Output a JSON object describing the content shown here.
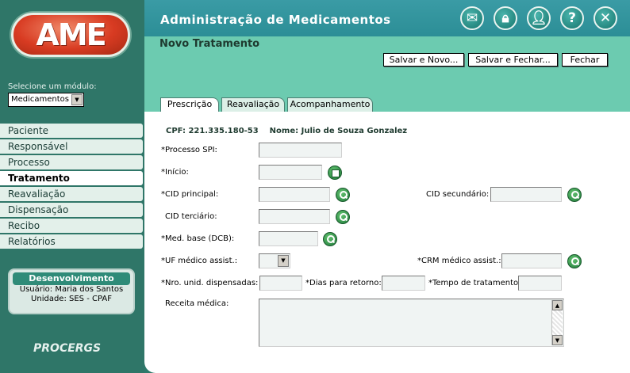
{
  "header": {
    "title": "Administração de Medicamentos",
    "icons": [
      "mail-icon",
      "lock-icon",
      "user-icon",
      "help-icon",
      "close-icon"
    ]
  },
  "sidebar": {
    "logo_text": "AME",
    "module_label": "Selecione um módulo:",
    "module_value": "Medicamentos",
    "items": [
      {
        "label": "Paciente",
        "active": false
      },
      {
        "label": "Responsável",
        "active": false
      },
      {
        "label": "Processo",
        "active": false
      },
      {
        "label": "Tratamento",
        "active": true
      },
      {
        "label": "Reavaliação",
        "active": false
      },
      {
        "label": "Dispensação",
        "active": false
      },
      {
        "label": "Recibo",
        "active": false
      },
      {
        "label": "Relatórios",
        "active": false
      }
    ],
    "env": {
      "title": "Desenvolvimento",
      "user": "Usuário: Maria dos Santos",
      "unit": "Unidade: SES - CPAF"
    },
    "footer_logo": "PROCERGS"
  },
  "main": {
    "section_title": "Novo Tratamento",
    "buttons": {
      "save_new": "Salvar e Novo...",
      "save_close": "Salvar e Fechar...",
      "close": "Fechar"
    },
    "tabs": [
      "Prescrição",
      "Reavaliação",
      "Acompanhamento"
    ],
    "active_tab": "Prescrição",
    "patient": {
      "cpf_label": "CPF:",
      "cpf": "221.335.180-53",
      "name_label": "Nome:",
      "name": "Julio de Souza Gonzalez"
    },
    "form": {
      "processo_spi": {
        "label": "*Processo SPI:",
        "value": ""
      },
      "inicio": {
        "label": "*Início:",
        "value": ""
      },
      "cid_principal": {
        "label": "*CID principal:",
        "value": ""
      },
      "cid_secundario": {
        "label": "CID secundário:",
        "value": ""
      },
      "cid_terciario": {
        "label": "CID terciário:",
        "value": ""
      },
      "med_base": {
        "label": "*Med. base (DCB):",
        "value": ""
      },
      "uf_medico": {
        "label": "*UF médico assist.:",
        "value": ""
      },
      "crm_medico": {
        "label": "*CRM médico assist.:",
        "value": ""
      },
      "nro_unid": {
        "label": "*Nro. unid. dispensadas:",
        "value": ""
      },
      "dias_retorno": {
        "label": "*Dias para retorno:",
        "value": ""
      },
      "tempo_tratamento": {
        "label": "*Tempo de tratamento:",
        "value": ""
      },
      "receita": {
        "label": "Receita médica:",
        "value": ""
      }
    }
  }
}
